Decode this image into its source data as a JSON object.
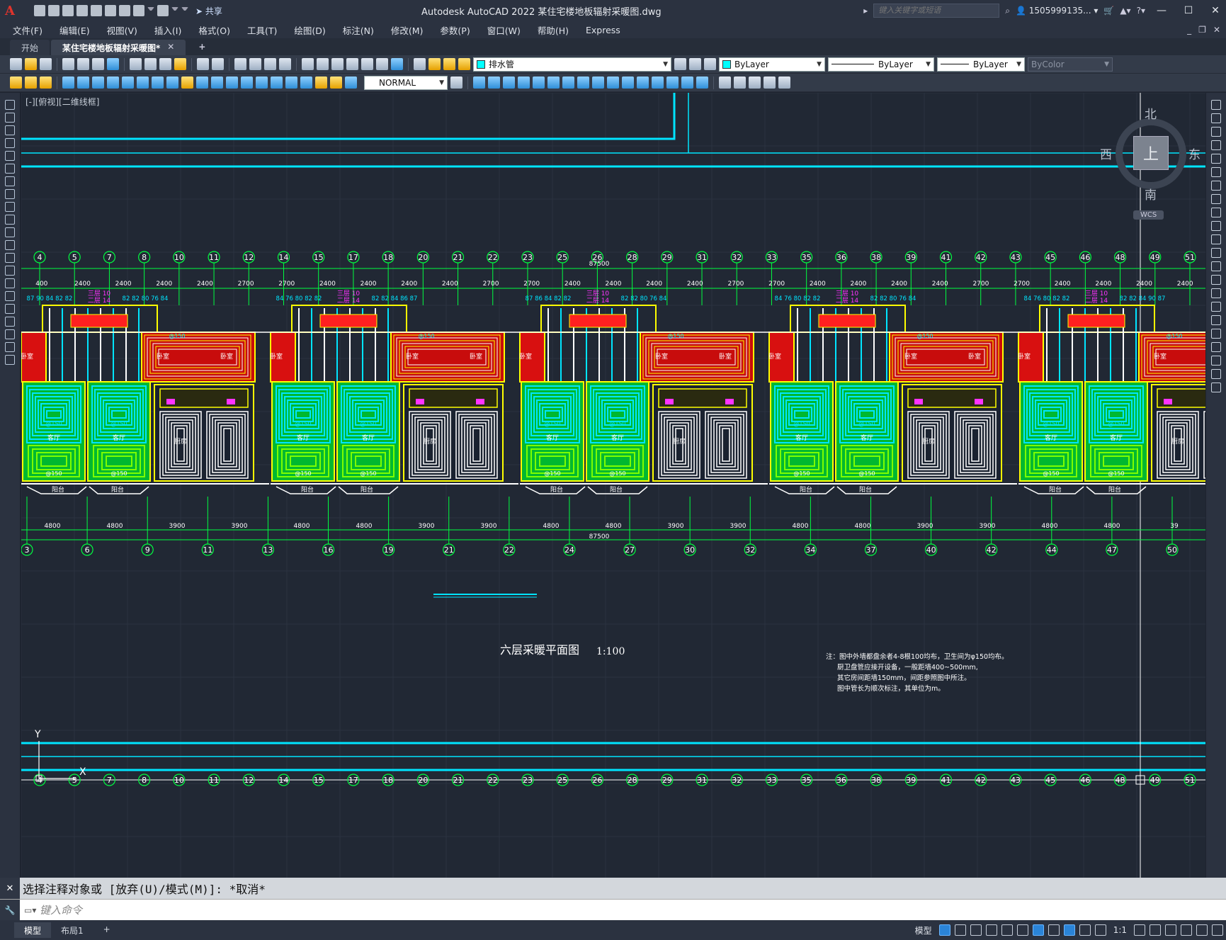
{
  "app": {
    "logo": "A",
    "window_title": "Autodesk AutoCAD 2022    某住宅楼地板辐射采暖图.dwg",
    "share_label": "共享",
    "search_placeholder": "键入关键字或短语",
    "user_name": "1505999135...",
    "minimize": "—",
    "maximize": "☐",
    "close": "✕"
  },
  "menu": {
    "items": [
      "文件(F)",
      "编辑(E)",
      "视图(V)",
      "插入(I)",
      "格式(O)",
      "工具(T)",
      "绘图(D)",
      "标注(N)",
      "修改(M)",
      "参数(P)",
      "窗口(W)",
      "帮助(H)",
      "Express"
    ]
  },
  "tabs": {
    "start": "开始",
    "active": "某住宅楼地板辐射采暖图*",
    "close": "✕",
    "new": "+"
  },
  "toolbar": {
    "layer_name": "排水管",
    "color": "ByLayer",
    "linetype": "ByLayer",
    "lineweight": "ByLayer",
    "plotstyle": "ByColor",
    "textstyle": "NORMAL",
    "layer_color_hex": "#00ffff"
  },
  "viewport": {
    "label": "[-][俯视][二维线框]",
    "compass_north": "北",
    "compass_south": "南",
    "compass_east": "东",
    "compass_west": "西",
    "cube_face": "上",
    "wcs": "WCS"
  },
  "drawing": {
    "title": "六层采暖平面图",
    "scale": "1:100",
    "notes": [
      "注：图中外墙都盘余者4-8根100均布，卫生间为φ150均布。",
      "厨卫盘管应接开设备，一般距墙400~500mm,",
      "其它房间距墙150mm，间距参照图中所注。",
      "图中管长为顺次标注，其单位为m。"
    ],
    "top_axes": [
      "4",
      "5",
      "7",
      "8",
      "10",
      "11",
      "12",
      "14",
      "15",
      "17",
      "18",
      "20",
      "21",
      "22",
      "23",
      "25",
      "26",
      "28",
      "29",
      "31",
      "32",
      "33",
      "35",
      "36",
      "38",
      "39",
      "41",
      "42",
      "43",
      "45",
      "46",
      "48",
      "49",
      "51"
    ],
    "top_dims": [
      "400",
      "2400",
      "2400",
      "2400",
      "2400",
      "2700",
      "2700",
      "2400",
      "2400",
      "2400",
      "2400",
      "2700",
      "2700",
      "2400",
      "2400",
      "2400",
      "2400",
      "2700",
      "2700",
      "2400",
      "2400",
      "2400",
      "2400",
      "2700",
      "2700",
      "2400",
      "2400",
      "2400",
      "2400"
    ],
    "top_total": "87500",
    "bottom_axes": [
      "3",
      "6",
      "9",
      "11",
      "13",
      "16",
      "19",
      "21",
      "22",
      "24",
      "27",
      "30",
      "32",
      "34",
      "37",
      "40",
      "42",
      "44",
      "47",
      "50"
    ],
    "bottom_dims": [
      "4800",
      "4800",
      "3900",
      "3900",
      "4800",
      "4800",
      "3900",
      "3900",
      "4800",
      "4800",
      "3900",
      "3900",
      "4800",
      "4800",
      "3900",
      "3900",
      "4800",
      "4800",
      "39"
    ],
    "bottom_total": "87500",
    "coil_labels_top": [
      "87 90 84 82 82",
      "82 82 80 76 84",
      "84 76 80 82 82",
      "82 82 84 86 87",
      "87 86 84 82 82",
      "82 82 80 76 84",
      "84 76 80 82 82",
      "82 82 80 76 84",
      "84 76 80 82 82",
      "82 82 84 90 87"
    ],
    "manifold_labels": [
      "三层 10",
      "二层 14"
    ],
    "room_bedroom": "卧室",
    "room_living": "客厅",
    "room_kitchen": "厨房",
    "room_balcony": "阳台",
    "spacing_label": "@150"
  },
  "command": {
    "history": "选择注释对象或 [放弃(U)/模式(M)]: *取消*",
    "placeholder": "键入命令"
  },
  "status": {
    "model_tab": "模型",
    "layout_tab": "布局1",
    "add_tab": "+",
    "model_label": "模型",
    "scale": "1:1"
  }
}
